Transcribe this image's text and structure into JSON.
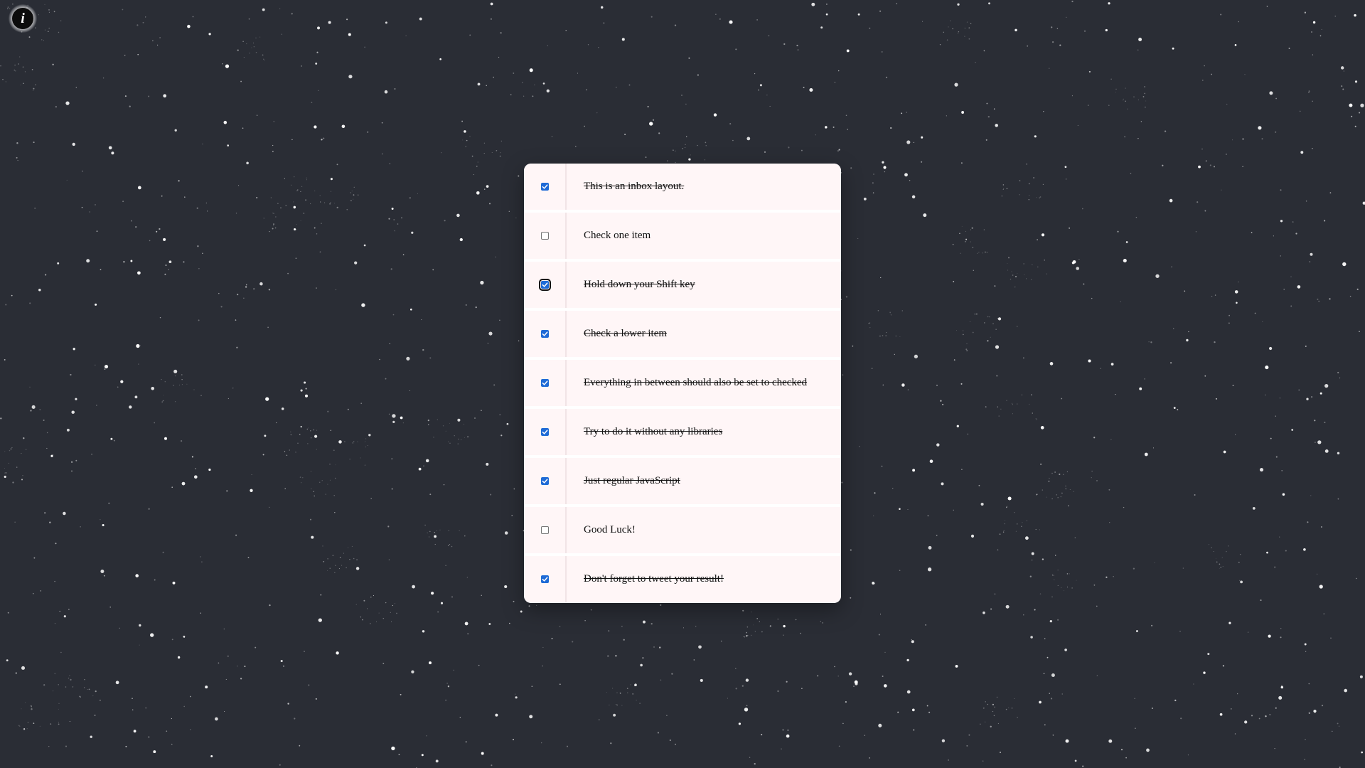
{
  "background": {
    "color": "#2a2d35",
    "star_color": "#ffffff"
  },
  "info_button": {
    "glyph": "i",
    "icon": "info-icon"
  },
  "inbox": {
    "accent_color": "#1f6bd6",
    "item_background": "#fff6f7",
    "items": [
      {
        "text": "This is an inbox layout.",
        "checked": true
      },
      {
        "text": "Check one item",
        "checked": false
      },
      {
        "text": "Hold down your Shift key",
        "checked": true,
        "focused": true
      },
      {
        "text": "Check a lower item",
        "checked": true
      },
      {
        "text": "Everything in between should also be set to checked",
        "checked": true
      },
      {
        "text": "Try to do it without any libraries",
        "checked": true
      },
      {
        "text": "Just regular JavaScript",
        "checked": true
      },
      {
        "text": "Good Luck!",
        "checked": false
      },
      {
        "text": "Don't forget to tweet your result!",
        "checked": true
      }
    ]
  }
}
